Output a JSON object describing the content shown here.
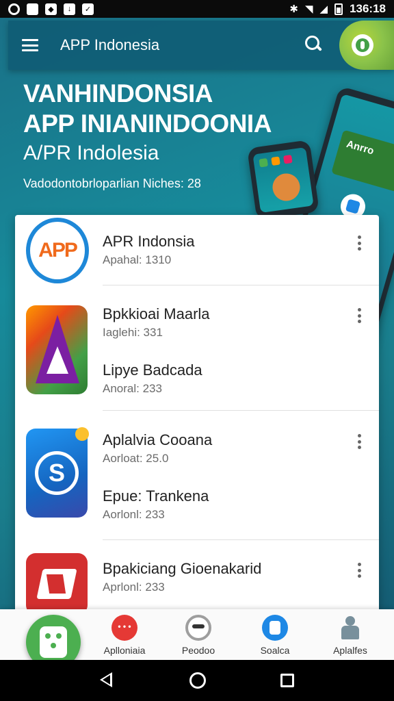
{
  "status_bar": {
    "time": "136:18",
    "icons": [
      "target-icon",
      "square-icon",
      "notification-icon",
      "download-icon",
      "check-icon",
      "bluetooth-icon",
      "wifi-icon",
      "signal-icon",
      "battery-icon"
    ]
  },
  "app_bar": {
    "title": "APP Indonesia",
    "icons": [
      "menu-icon",
      "search-icon",
      "avatar-icon"
    ]
  },
  "hero": {
    "title_line1": "VANHINDONSIA",
    "title_line2": "APP INIANINDOONIA",
    "subtitle": "A/PR Indolesia",
    "meta": "Vadodontobrloparlian Niches: 28"
  },
  "illustration": {
    "big_phone_label": "Anrro"
  },
  "app_list": [
    {
      "title": "APR Indonsia",
      "subtitle": "Apahal: 1310",
      "icon_text": "APP",
      "icon": "app-logo-icon"
    },
    {
      "title": "Bpkkioai Maarla",
      "subtitle": "Iaglehi: 331",
      "icon": "triangle-logo-icon"
    },
    {
      "title": "Lipye Badcada",
      "subtitle": "Anoral: 233",
      "icon": null
    },
    {
      "title": "Aplalvia Cooana",
      "subtitle": "Aorloat: 25.0",
      "icon_text": "S",
      "icon": "s-logo-icon"
    },
    {
      "title": "Epue: Trankena",
      "subtitle": "Aorlonl: 233",
      "icon": null
    },
    {
      "title": "Bpakiciang Gioenakarid",
      "subtitle": "Aprlonl: 233",
      "icon": "red-logo-icon"
    }
  ],
  "bottom_nav": {
    "items": [
      {
        "label": "Aplloniaia",
        "icon": "apps-icon"
      },
      {
        "label": "Peodoo",
        "icon": "games-icon"
      },
      {
        "label": "Soalca",
        "icon": "search-tab-icon"
      },
      {
        "label": "Aplalfes",
        "icon": "updates-icon"
      }
    ],
    "fab_icon": "store-icon"
  },
  "system_nav": [
    "back-icon",
    "home-icon",
    "recents-icon"
  ],
  "colors": {
    "header_bg": "#0f5a73",
    "accent": "#1e88d8",
    "avatar_bg": "#8bc34a"
  }
}
